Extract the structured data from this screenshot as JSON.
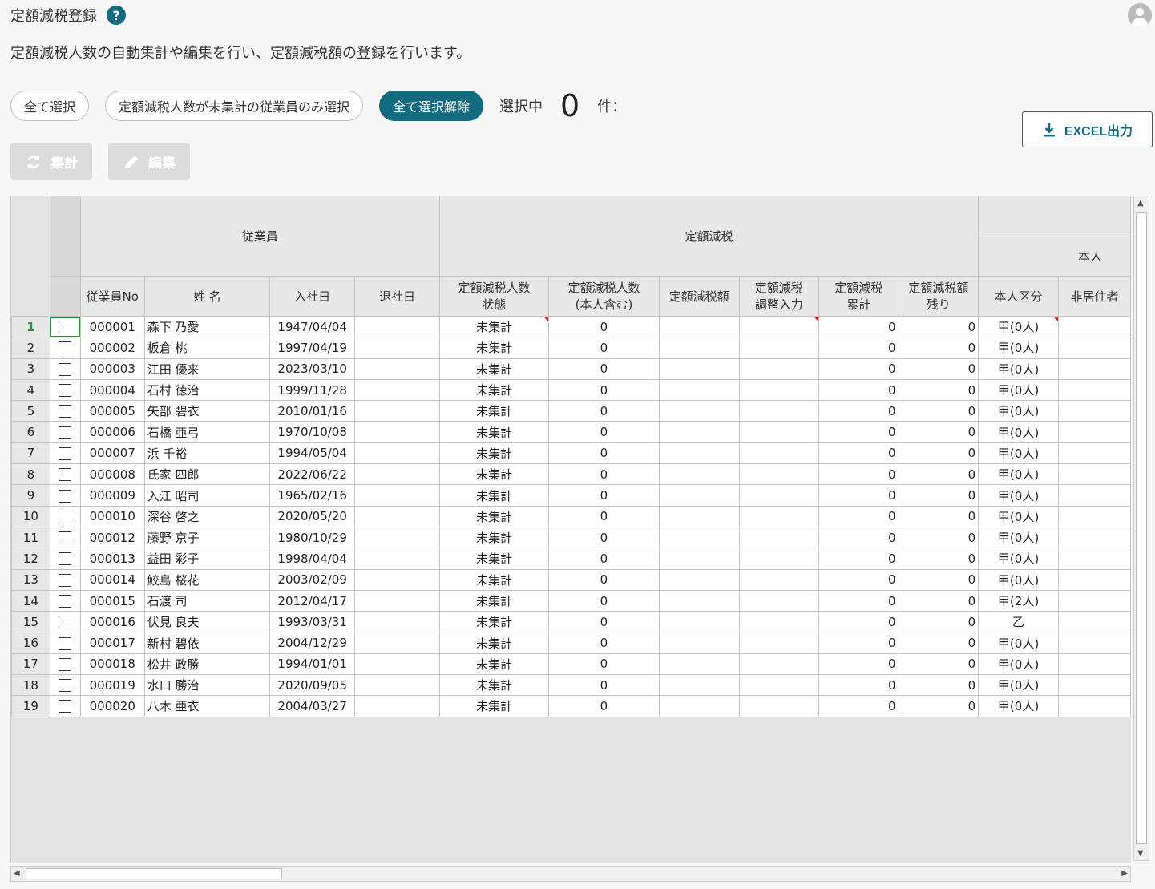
{
  "page": {
    "title": "定額減税登録",
    "help_icon": "?",
    "description": "定額減税人数の自動集計や編集を行い、定額減税額の登録を行います。"
  },
  "toolbar": {
    "select_all": "全て選択",
    "select_unaggregated": "定額減税人数が未集計の従業員のみ選択",
    "deselect_all": "全て選択解除",
    "selecting_label": "選択中",
    "selected_count": "0",
    "count_unit": "件：",
    "excel_export": "EXCEL出力",
    "aggregate": "集計",
    "edit": "編集"
  },
  "grid": {
    "group_headers": {
      "employee": "従業員",
      "tax_reduction": "定額減税",
      "self": "本人"
    },
    "columns": {
      "emp_no": "従業員No",
      "name": "姓 名",
      "hire_date": "入社日",
      "leave_date": "退社日",
      "count_status": "定額減税人数\n状態",
      "count_incl_self": "定額減税人数\n(本人含む)",
      "amount": "定額減税額",
      "adjust_input": "定額減税\n調整入力",
      "cumulative": "定額減税\n累計",
      "remaining": "定額減税額\n残り",
      "self_category": "本人区分",
      "non_resident": "非居住者"
    },
    "rows": [
      {
        "n": "1",
        "no": "000001",
        "name": "森下 乃愛",
        "hire": "1947/04/04",
        "status": "未集計",
        "count": "0",
        "cum": "0",
        "rem": "0",
        "cat": "甲(0人)"
      },
      {
        "n": "2",
        "no": "000002",
        "name": "板倉 桃",
        "hire": "1997/04/19",
        "status": "未集計",
        "count": "0",
        "cum": "0",
        "rem": "0",
        "cat": "甲(0人)"
      },
      {
        "n": "3",
        "no": "000003",
        "name": "江田 優来",
        "hire": "2023/03/10",
        "status": "未集計",
        "count": "0",
        "cum": "0",
        "rem": "0",
        "cat": "甲(0人)"
      },
      {
        "n": "4",
        "no": "000004",
        "name": "石村 徳治",
        "hire": "1999/11/28",
        "status": "未集計",
        "count": "0",
        "cum": "0",
        "rem": "0",
        "cat": "甲(0人)"
      },
      {
        "n": "5",
        "no": "000005",
        "name": "矢部 碧衣",
        "hire": "2010/01/16",
        "status": "未集計",
        "count": "0",
        "cum": "0",
        "rem": "0",
        "cat": "甲(0人)"
      },
      {
        "n": "6",
        "no": "000006",
        "name": "石橋 亜弓",
        "hire": "1970/10/08",
        "status": "未集計",
        "count": "0",
        "cum": "0",
        "rem": "0",
        "cat": "甲(0人)"
      },
      {
        "n": "7",
        "no": "000007",
        "name": "浜 千裕",
        "hire": "1994/05/04",
        "status": "未集計",
        "count": "0",
        "cum": "0",
        "rem": "0",
        "cat": "甲(0人)"
      },
      {
        "n": "8",
        "no": "000008",
        "name": "氏家 四郎",
        "hire": "2022/06/22",
        "status": "未集計",
        "count": "0",
        "cum": "0",
        "rem": "0",
        "cat": "甲(0人)"
      },
      {
        "n": "9",
        "no": "000009",
        "name": "入江 昭司",
        "hire": "1965/02/16",
        "status": "未集計",
        "count": "0",
        "cum": "0",
        "rem": "0",
        "cat": "甲(0人)"
      },
      {
        "n": "10",
        "no": "000010",
        "name": "深谷 啓之",
        "hire": "2020/05/20",
        "status": "未集計",
        "count": "0",
        "cum": "0",
        "rem": "0",
        "cat": "甲(0人)"
      },
      {
        "n": "11",
        "no": "000012",
        "name": "藤野 京子",
        "hire": "1980/10/29",
        "status": "未集計",
        "count": "0",
        "cum": "0",
        "rem": "0",
        "cat": "甲(0人)"
      },
      {
        "n": "12",
        "no": "000013",
        "name": "益田 彩子",
        "hire": "1998/04/04",
        "status": "未集計",
        "count": "0",
        "cum": "0",
        "rem": "0",
        "cat": "甲(0人)"
      },
      {
        "n": "13",
        "no": "000014",
        "name": "鮫島 桜花",
        "hire": "2003/02/09",
        "status": "未集計",
        "count": "0",
        "cum": "0",
        "rem": "0",
        "cat": "甲(0人)"
      },
      {
        "n": "14",
        "no": "000015",
        "name": "石渡 司",
        "hire": "2012/04/17",
        "status": "未集計",
        "count": "0",
        "cum": "0",
        "rem": "0",
        "cat": "甲(2人)"
      },
      {
        "n": "15",
        "no": "000016",
        "name": "伏見 良夫",
        "hire": "1993/03/31",
        "status": "未集計",
        "count": "0",
        "cum": "0",
        "rem": "0",
        "cat": "乙"
      },
      {
        "n": "16",
        "no": "000017",
        "name": "新村 碧依",
        "hire": "2004/12/29",
        "status": "未集計",
        "count": "0",
        "cum": "0",
        "rem": "0",
        "cat": "甲(0人)"
      },
      {
        "n": "17",
        "no": "000018",
        "name": "松井 政勝",
        "hire": "1994/01/01",
        "status": "未集計",
        "count": "0",
        "cum": "0",
        "rem": "0",
        "cat": "甲(0人)"
      },
      {
        "n": "18",
        "no": "000019",
        "name": "水口 勝治",
        "hire": "2020/09/05",
        "status": "未集計",
        "count": "0",
        "cum": "0",
        "rem": "0",
        "cat": "甲(0人)"
      },
      {
        "n": "19",
        "no": "000020",
        "name": "八木 亜衣",
        "hire": "2004/03/27",
        "status": "未集計",
        "count": "0",
        "cum": "0",
        "rem": "0",
        "cat": "甲(0人)"
      }
    ]
  },
  "colors": {
    "accent": "#136b80",
    "row_number_active": "#2a8c3a",
    "comment_marker": "#e02020"
  }
}
